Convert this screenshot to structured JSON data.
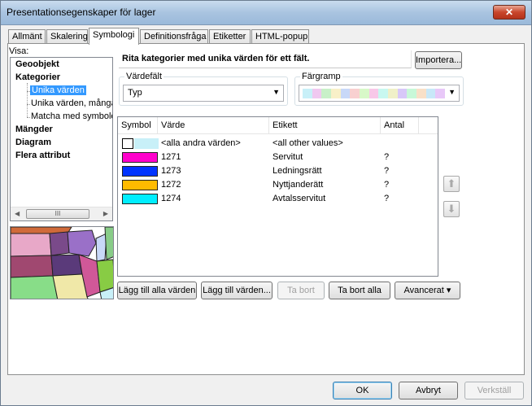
{
  "window": {
    "title": "Presentationsegenskaper för lager",
    "close_glyph": "✕"
  },
  "tabs": [
    {
      "label": "Allmänt"
    },
    {
      "label": "Skalering"
    },
    {
      "label": "Symbologi",
      "active": true
    },
    {
      "label": "Definitionsfråga"
    },
    {
      "label": "Etiketter"
    },
    {
      "label": "HTML-popup"
    }
  ],
  "visa": {
    "label": "Visa:",
    "items": {
      "geoobjekt": "Geoobjekt",
      "kategorier": "Kategorier",
      "unika_varden": "Unika värden",
      "unika_varden_manga": "Unika värden, många",
      "matcha": "Matcha med symboler",
      "mangder": "Mängder",
      "diagram": "Diagram",
      "flera_attribut": "Flera attribut"
    },
    "scroll_thumb": "III"
  },
  "description": "Rita kategorier med unika värden för ett fält.",
  "import_button": "Importera...",
  "value_field": {
    "label": "Värdefält",
    "selected": "Typ"
  },
  "color_ramp": {
    "label": "Färgramp",
    "colors": [
      "#c8f0f8",
      "#f0c8f0",
      "#c8f0c8",
      "#f8f0c8",
      "#c8d8f8",
      "#f8d0d0",
      "#d8f8c8",
      "#f8c8e8",
      "#c8f8f0",
      "#f0f0c8",
      "#d8c8f8",
      "#c8f8d8",
      "#f8e0c8",
      "#c8e8f8",
      "#e8c8f8"
    ]
  },
  "table": {
    "headers": {
      "symbol": "Symbol",
      "varde": "Värde",
      "etikett": "Etikett",
      "antal": "Antal"
    },
    "rows": [
      {
        "varde": "<alla andra värden>",
        "etikett": "<all other values>",
        "antal": "",
        "color": "#ffffff",
        "color2": "#c8f0f8"
      },
      {
        "varde": "1271",
        "etikett": "Servitut",
        "antal": "?",
        "color": "#ff00cc"
      },
      {
        "varde": "1273",
        "etikett": "Ledningsrätt",
        "antal": "?",
        "color": "#0033ff"
      },
      {
        "varde": "1272",
        "etikett": "Nyttjanderätt",
        "antal": "?",
        "color": "#ffbb00"
      },
      {
        "varde": "1274",
        "etikett": "Avtalsservitut",
        "antal": "?",
        "color": "#00eeff"
      }
    ]
  },
  "buttons": {
    "add_all": "Lägg till alla värden",
    "add_values": "Lägg till värden...",
    "remove": "Ta bort",
    "remove_all": "Ta bort alla",
    "advanced": "Avancerat",
    "advanced_arrow": "▾"
  },
  "footer": {
    "ok": "OK",
    "cancel": "Avbryt",
    "apply": "Verkställ"
  },
  "icons": {
    "up": "up-arrow-icon",
    "down": "down-arrow-icon"
  }
}
